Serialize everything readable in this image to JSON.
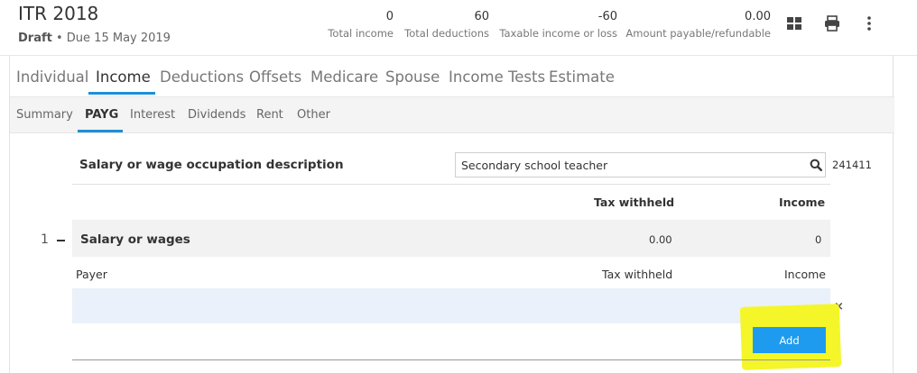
{
  "header": {
    "title": "ITR 2018",
    "status": "Draft",
    "due": "• Due 15 May 2019",
    "stats": [
      {
        "value": "0",
        "label": "Total income"
      },
      {
        "value": "60",
        "label": "Total deductions"
      },
      {
        "value": "-60",
        "label": "Taxable income or loss"
      },
      {
        "value": "0.00",
        "label": "Amount payable/refundable"
      }
    ],
    "icons": [
      "grid-icon",
      "print-icon",
      "more-vertical-icon"
    ]
  },
  "tabs": [
    "Individual",
    "Income",
    "Deductions",
    "Offsets",
    "Medicare",
    "Spouse",
    "Income Tests",
    "Estimate"
  ],
  "active_tab": "Income",
  "subtabs": [
    "Summary",
    "PAYG",
    "Interest",
    "Dividends",
    "Rent",
    "Other"
  ],
  "active_subtab": "PAYG",
  "occupation": {
    "label": "Salary or wage occupation description",
    "value": "Secondary school teacher",
    "code": "241411"
  },
  "columns": {
    "tax_withheld": "Tax withheld",
    "income": "Income"
  },
  "salary_row": {
    "number": "1",
    "label": "Salary or wages",
    "tax_withheld": "0.00",
    "income": "0"
  },
  "payer_columns": {
    "payer": "Payer",
    "tax_withheld": "Tax withheld",
    "income": "Income"
  },
  "close_glyph": "×",
  "add_label": "Add",
  "colors": {
    "accent": "#1e8fd6",
    "button": "#1e9bee",
    "highlight": "#f4f629",
    "entry_row": "#eaf1fa"
  }
}
